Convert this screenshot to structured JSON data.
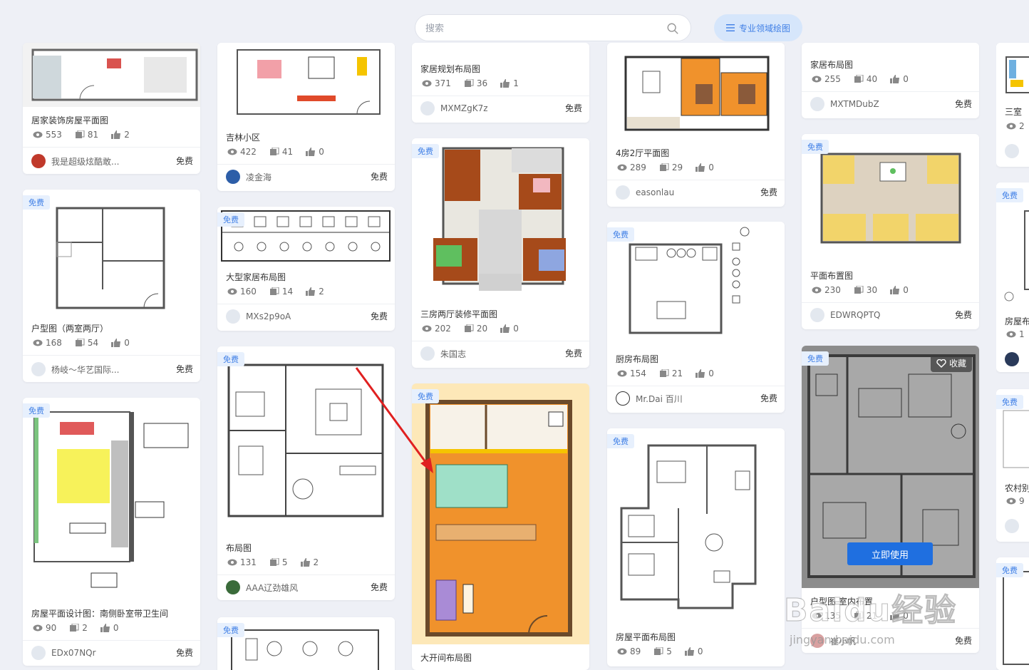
{
  "search": {
    "placeholder": "搜索"
  },
  "pro_button": {
    "label": "专业领域绘图"
  },
  "cards": {
    "c0": {
      "title": "居家装饰房屋平面图",
      "views": "553",
      "comments": "81",
      "likes": "2",
      "author": "我是超级炫酷敢...",
      "price": "免费"
    },
    "c1": {
      "badge": "免费",
      "title": "户型图（两室两厅）",
      "views": "168",
      "comments": "54",
      "likes": "0",
      "author": "杨岐～华艺国际...",
      "price": "免费"
    },
    "c2": {
      "badge": "免费",
      "title": "房屋平面设计图：南侧卧室带卫生间",
      "views": "90",
      "comments": "2",
      "likes": "0",
      "author": "EDx07NQr",
      "price": "免费"
    },
    "c3": {
      "title": "吉林小区",
      "views": "422",
      "comments": "41",
      "likes": "0",
      "author": "凌金海",
      "price": "免费"
    },
    "c4": {
      "badge": "免费",
      "title": "大型家居布局图",
      "views": "160",
      "comments": "14",
      "likes": "2",
      "author": "MXs2p9oA",
      "price": "免费"
    },
    "c5": {
      "badge": "免费",
      "title": "布局图",
      "views": "131",
      "comments": "5",
      "likes": "2",
      "author": "AAA辽劲雄风",
      "price": "免费"
    },
    "c6": {
      "badge": "免费"
    },
    "c7": {
      "title": "家居规划布局图",
      "views": "371",
      "comments": "36",
      "likes": "1",
      "author": "MXMZgK7z",
      "price": "免费"
    },
    "c8": {
      "badge": "免费",
      "title": "三房两厅装修平面图",
      "views": "202",
      "comments": "20",
      "likes": "0",
      "author": "朱国志",
      "price": "免费"
    },
    "c9": {
      "badge": "免费",
      "title": "大开间布局图"
    },
    "c10": {
      "title": "4房2厅平面图",
      "views": "289",
      "comments": "29",
      "likes": "0",
      "author": "easonlau",
      "price": "免费"
    },
    "c11": {
      "badge": "免费",
      "title": "厨房布局图",
      "views": "154",
      "comments": "21",
      "likes": "0",
      "author": "Mr.Dai 百川",
      "price": "免费"
    },
    "c12": {
      "badge": "免费",
      "title": "房屋平面布局图",
      "views": "89",
      "comments": "5",
      "likes": "0"
    },
    "c13": {
      "title": "家居布局图",
      "views": "255",
      "comments": "40",
      "likes": "0",
      "author": "MXTMDubZ",
      "price": "免费"
    },
    "c14": {
      "badge": "免费",
      "title": "平面布置图",
      "views": "230",
      "comments": "30",
      "likes": "0",
      "author": "EDWRQPTQ",
      "price": "免费"
    },
    "c15": {
      "badge": "免费",
      "title": "户型图 室内布置",
      "views": "135",
      "comments": "21",
      "likes": "0",
      "author": "崔小帆",
      "price": "免费",
      "fav": "收藏",
      "use": "立即使用"
    },
    "c16": {
      "title": "三室",
      "views": "2"
    },
    "c17": {
      "badge": "免费",
      "title": "房屋布",
      "views": "1"
    },
    "c18": {
      "badge": "免费",
      "title": "农村别",
      "views": "9"
    },
    "c19": {
      "badge": "免费"
    }
  },
  "watermark": {
    "text": "Baidu经验",
    "sub": "jingyan.baidu.com"
  },
  "colors": {
    "accent": "#3f7fe6",
    "use_button": "#1f6fe0",
    "orange_room": "#f0922c",
    "arrow": "#e02020"
  }
}
